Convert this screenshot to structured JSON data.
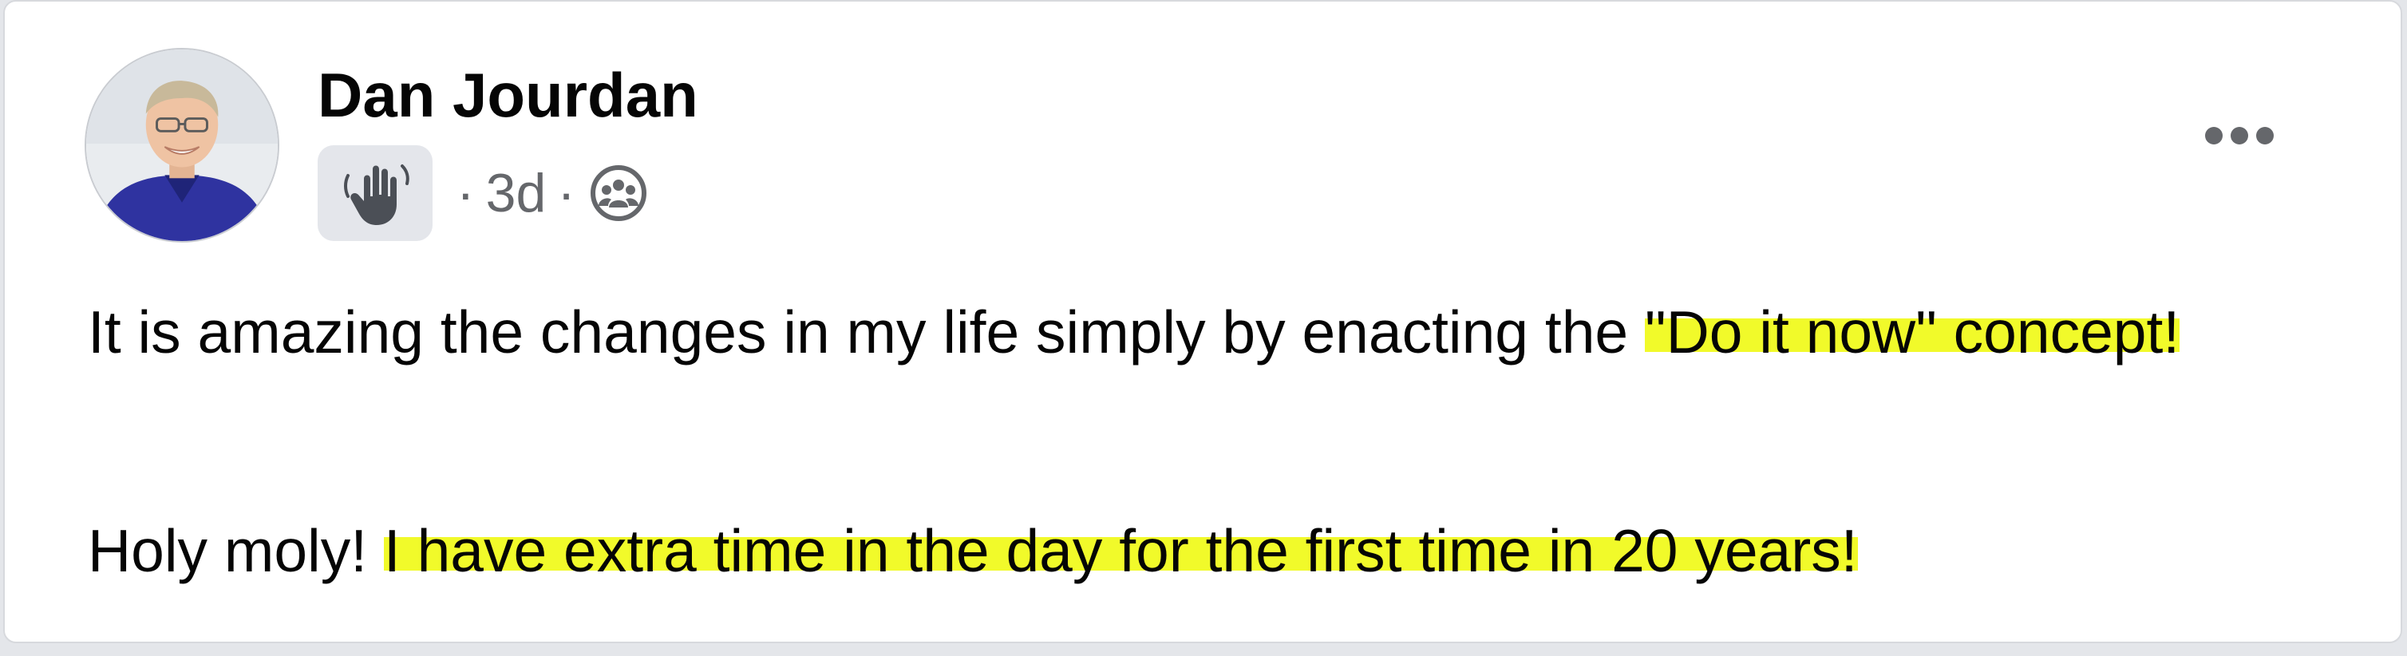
{
  "post": {
    "author": "Dan Jourdan",
    "badge_icon": "wave-hand-icon",
    "time": "3d",
    "separator": "·",
    "audience_icon": "group-audience-icon",
    "more_icon": "more-options-icon",
    "paragraph1": {
      "plain": "It is amazing the changes in my life simply by enacting the ",
      "highlight": "\"Do it now\" concept!"
    },
    "paragraph2": {
      "plain": "Holy moly! ",
      "highlight": "I have extra time in the day for the first time in 20 years!"
    }
  },
  "colors": {
    "highlight": "#f1fa2a",
    "text": "#050505",
    "secondary_text": "#65676b",
    "badge_bg": "#e4e6eb",
    "card_bg": "#ffffff"
  }
}
